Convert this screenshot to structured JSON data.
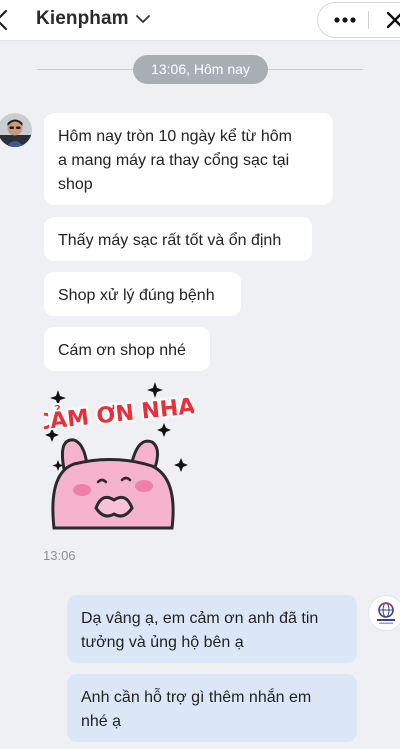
{
  "header": {
    "contact_name": "Kienpham",
    "back_icon": "chevron-left-icon",
    "name_menu_icon": "chevron-down-icon",
    "more_icon": "more-dots-icon",
    "close_icon": "close-icon"
  },
  "divider": {
    "time_label": "13:06, Hôm nay"
  },
  "messages_incoming": [
    {
      "text": "Hôm nay tròn 10 ngày kể từ hôm\na mang máy ra thay cổng sạc tại\nshop"
    },
    {
      "text": "Thấy máy sạc rất tốt và ổn định"
    },
    {
      "text": "Shop xử lý đúng bệnh"
    },
    {
      "text": "Cám ơn shop nhé"
    }
  ],
  "sticker": {
    "caption": "CẢM ƠN NHA!",
    "icon": "pink-bunny-sticker-icon"
  },
  "incoming_timestamp": "13:06",
  "messages_outgoing": [
    {
      "text": "Dạ vâng ạ, em cảm ơn anh đã tin\ntưởng và ủng hộ bên ạ"
    },
    {
      "text": "Anh cần hỗ trợ gì thêm nhắn em\nnhé ạ"
    }
  ],
  "colors": {
    "background": "#eef0f3",
    "incoming_bubble": "#ffffff",
    "outgoing_bubble": "#dbe7f7",
    "time_pill": "#a9adb4",
    "sticker_text": "#e8303a",
    "sticker_bunny": "#f6b3cc"
  }
}
